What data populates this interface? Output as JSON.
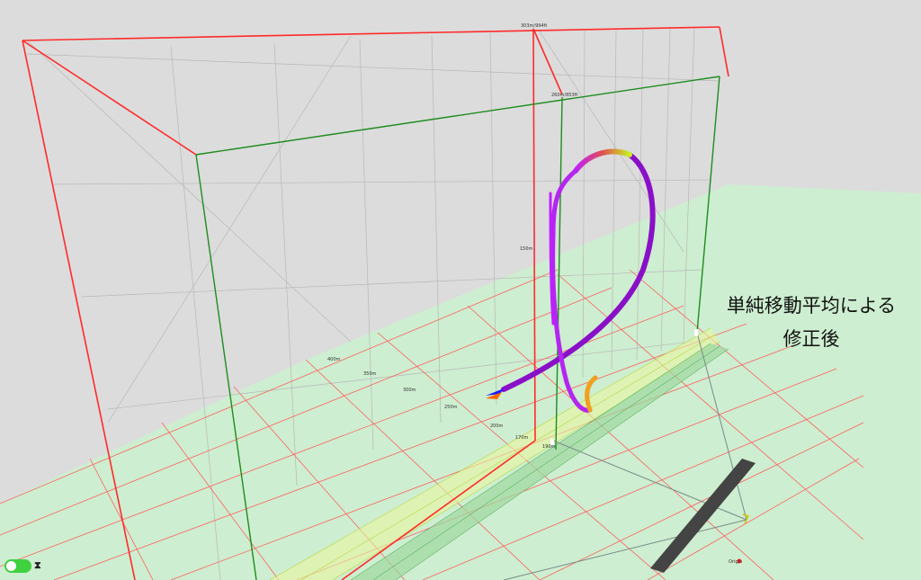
{
  "caption": {
    "line1": "単純移動平均による",
    "line2": "修正後"
  },
  "labels": {
    "top_red": "303m/994ft",
    "top_green": "260m/853ft",
    "alt_150": "150m",
    "alt_170": "170m",
    "alt_190": "190m",
    "dist_400": "400m",
    "dist_350": "350m",
    "dist_300": "300m",
    "dist_250": "250m",
    "dist_200": "200m",
    "origin": "Origin"
  },
  "controls": {
    "toggle_on": true,
    "toggle_icon": "motion-icon"
  },
  "colors": {
    "red_frame": "#ff2a2a",
    "green_frame": "#1e8c1e",
    "ground": "#cdeed0",
    "ribbon_purple": "#8a10c8",
    "ribbon_magenta": "#c020ff",
    "runway": "#444444"
  }
}
